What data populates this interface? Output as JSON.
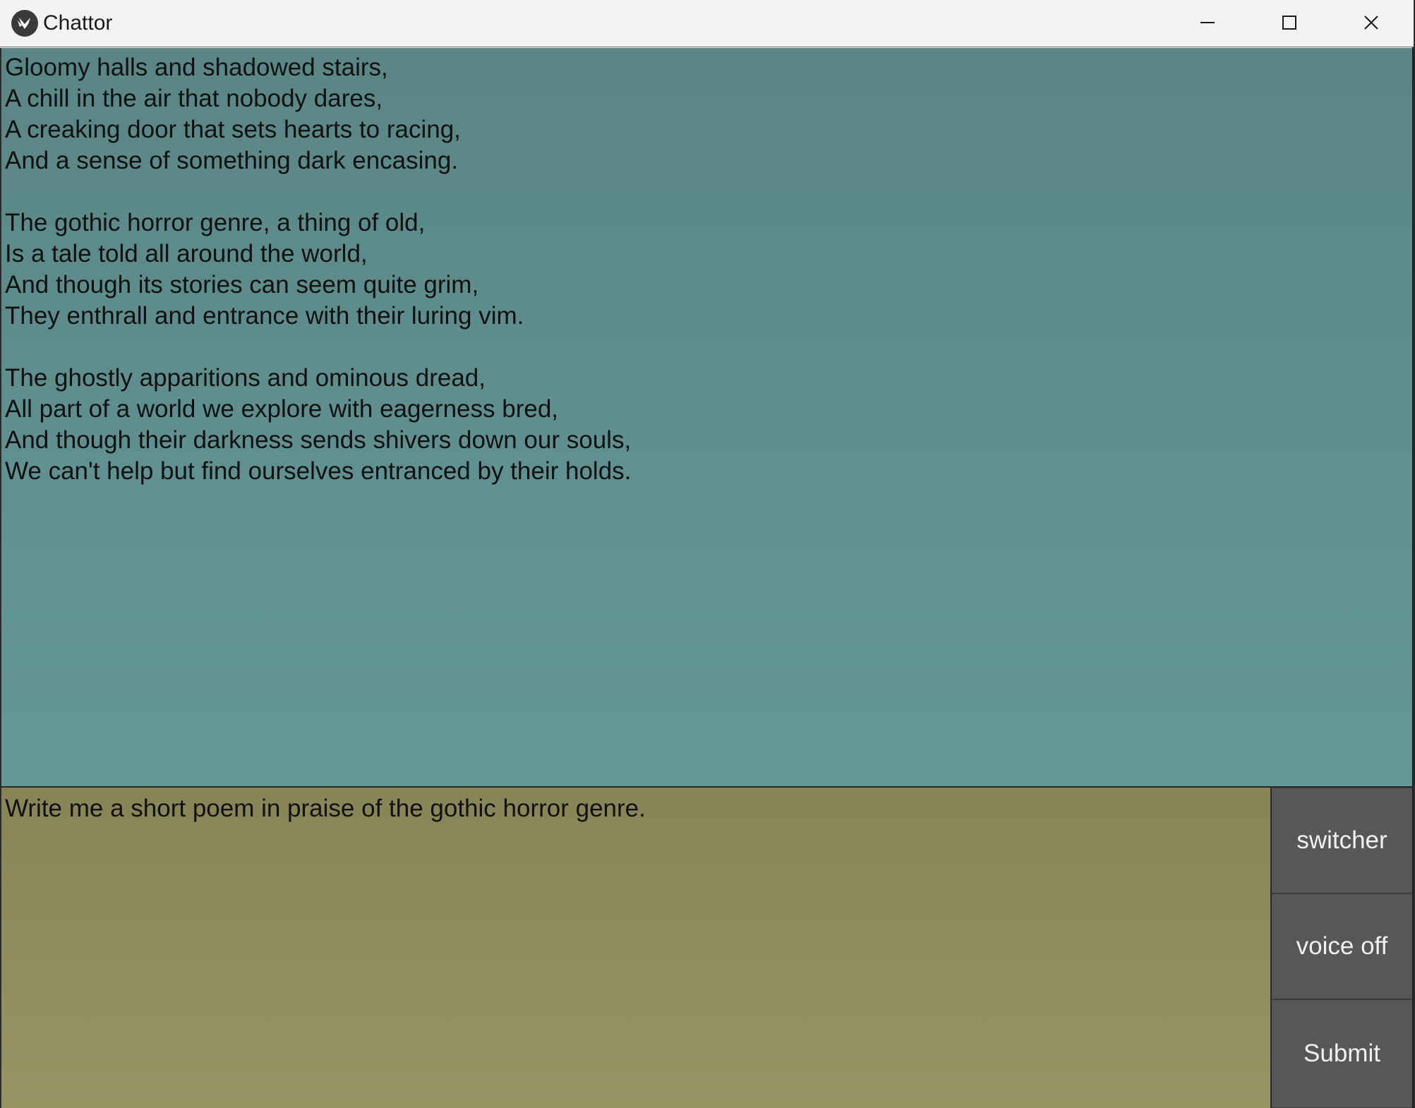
{
  "window": {
    "title": "Chattor",
    "icon": "kivy-logo-icon"
  },
  "output": {
    "text": "Gloomy halls and shadowed stairs,\nA chill in the air that nobody dares,\nA creaking door that sets hearts to racing,\nAnd a sense of something dark encasing.\n\nThe gothic horror genre, a thing of old,\nIs a tale told all around the world,\nAnd though its stories can seem quite grim,\nThey enthrall and entrance with their luring vim.\n\nThe ghostly apparitions and ominous dread,\nAll part of a world we explore with eagerness bred,\nAnd though their darkness sends shivers down our souls,\nWe can't help but find ourselves entranced by their holds."
  },
  "input": {
    "value": "Write me a short poem in praise of the gothic horror genre."
  },
  "buttons": {
    "switcher": "switcher",
    "voice": "voice off",
    "submit": "Submit"
  },
  "colors": {
    "output_bg": "#5f8f8f",
    "input_bg": "#8f8c5e",
    "button_bg": "#575757"
  }
}
